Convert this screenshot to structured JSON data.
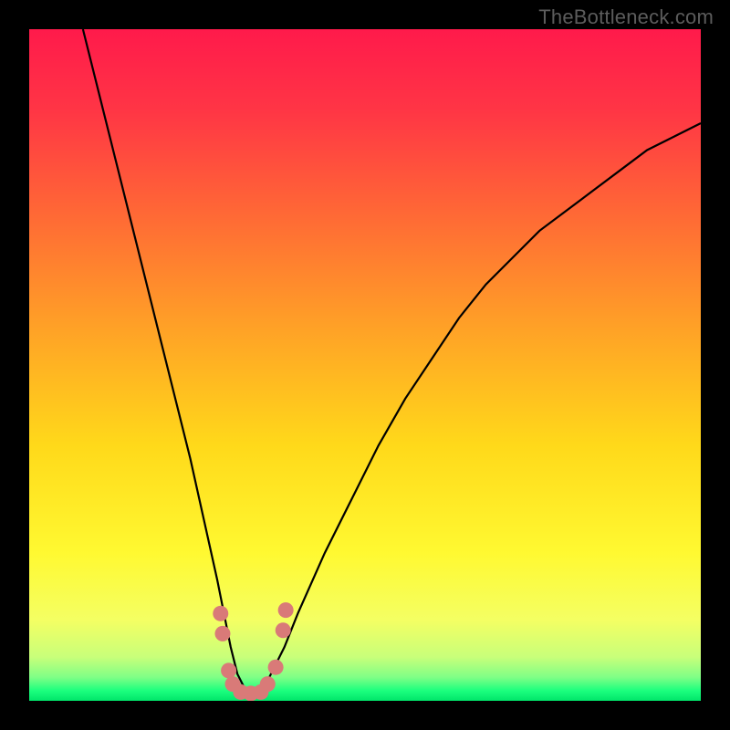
{
  "watermark": "TheBottleneck.com",
  "gradient": {
    "stops": [
      {
        "offset": 0.0,
        "color": "#ff1a4b"
      },
      {
        "offset": 0.12,
        "color": "#ff3545"
      },
      {
        "offset": 0.28,
        "color": "#ff6a35"
      },
      {
        "offset": 0.45,
        "color": "#ffa326"
      },
      {
        "offset": 0.62,
        "color": "#ffd91a"
      },
      {
        "offset": 0.78,
        "color": "#fff931"
      },
      {
        "offset": 0.88,
        "color": "#f4ff63"
      },
      {
        "offset": 0.935,
        "color": "#c8ff7a"
      },
      {
        "offset": 0.965,
        "color": "#7fff86"
      },
      {
        "offset": 0.985,
        "color": "#1bff7e"
      },
      {
        "offset": 1.0,
        "color": "#00e56a"
      }
    ]
  },
  "chart_data": {
    "type": "line",
    "title": "",
    "xlabel": "",
    "ylabel": "",
    "xlim": [
      0,
      100
    ],
    "ylim": [
      0,
      100
    ],
    "series": [
      {
        "name": "bottleneck-curve",
        "x": [
          8,
          10,
          12,
          14,
          16,
          18,
          20,
          22,
          24,
          26,
          28,
          29,
          30,
          31,
          32,
          33,
          34,
          35,
          36,
          38,
          40,
          44,
          48,
          52,
          56,
          60,
          64,
          68,
          72,
          76,
          80,
          84,
          88,
          92,
          96,
          100
        ],
        "y": [
          100,
          92,
          84,
          76,
          68,
          60,
          52,
          44,
          36,
          27,
          18,
          13,
          8,
          4,
          2,
          1,
          1,
          2,
          4,
          8,
          13,
          22,
          30,
          38,
          45,
          51,
          57,
          62,
          66,
          70,
          73,
          76,
          79,
          82,
          84,
          86
        ]
      }
    ],
    "markers": {
      "name": "highlight-dots",
      "color": "#d97a78",
      "points": [
        {
          "x": 28.5,
          "y": 13
        },
        {
          "x": 28.8,
          "y": 10
        },
        {
          "x": 29.7,
          "y": 4.5
        },
        {
          "x": 30.3,
          "y": 2.5
        },
        {
          "x": 31.5,
          "y": 1.3
        },
        {
          "x": 33.0,
          "y": 1.1
        },
        {
          "x": 34.5,
          "y": 1.3
        },
        {
          "x": 35.5,
          "y": 2.5
        },
        {
          "x": 36.7,
          "y": 5.0
        },
        {
          "x": 37.8,
          "y": 10.5
        },
        {
          "x": 38.2,
          "y": 13.5
        }
      ]
    }
  }
}
